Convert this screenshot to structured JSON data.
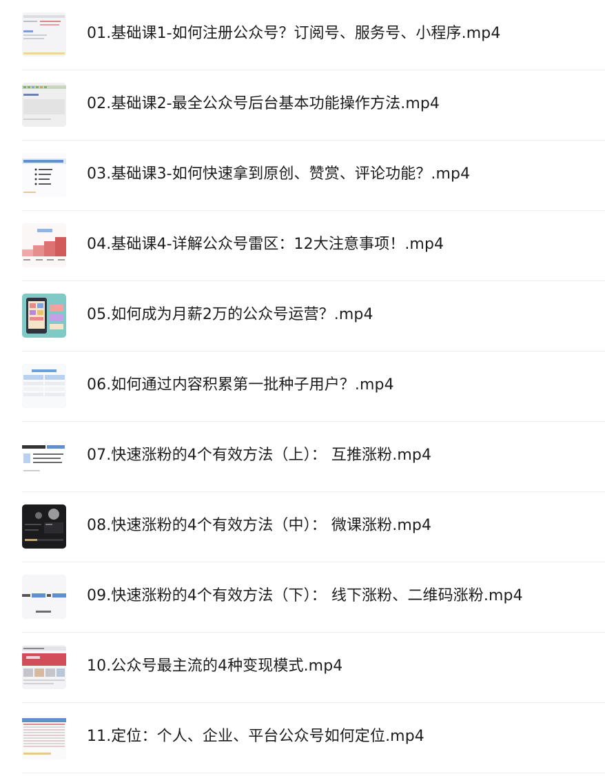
{
  "files": [
    {
      "name": "01.基础课1-如何注册公众号？订阅号、服务号、小程序.mp4",
      "thumb_icon": "admin-page-thumbnail-icon"
    },
    {
      "name": "02.基础课2-最全公众号后台基本功能操作方法.mp4",
      "thumb_icon": "dashboard-thumbnail-icon"
    },
    {
      "name": "03.基础课3-如何快速拿到原创、赞赏、评论功能？.mp4",
      "thumb_icon": "slide-bullets-thumbnail-icon"
    },
    {
      "name": "04.基础课4-详解公众号雷区：12大注意事项！.mp4",
      "thumb_icon": "bar-steps-thumbnail-icon"
    },
    {
      "name": "05.如何成为月薪2万的公众号运营？.mp4",
      "thumb_icon": "phone-illustration-thumbnail-icon"
    },
    {
      "name": "06.如何通过内容积累第一批种子用户？.mp4",
      "thumb_icon": "table-slide-thumbnail-icon"
    },
    {
      "name": "07.快速涨粉的4个有效方法（上）： 互推涨粉.mp4",
      "thumb_icon": "text-slide-thumbnail-icon"
    },
    {
      "name": "08.快速涨粉的4个有效方法（中）： 微课涨粉.mp4",
      "thumb_icon": "dark-video-thumbnail-icon"
    },
    {
      "name": "09.快速涨粉的4个有效方法（下）： 线下涨粉、二维码涨粉.mp4",
      "thumb_icon": "banner-slide-thumbnail-icon"
    },
    {
      "name": "10.公众号最主流的4种变现模式.mp4",
      "thumb_icon": "web-store-thumbnail-icon"
    },
    {
      "name": "11.定位：个人、企业、平台公众号如何定位.mp4",
      "thumb_icon": "spreadsheet-thumbnail-icon"
    }
  ],
  "colors": {
    "text": "#1c1c1e",
    "separator": "#ececee",
    "accent_blue": "#4a90d9",
    "accent_red": "#c94b4b"
  }
}
